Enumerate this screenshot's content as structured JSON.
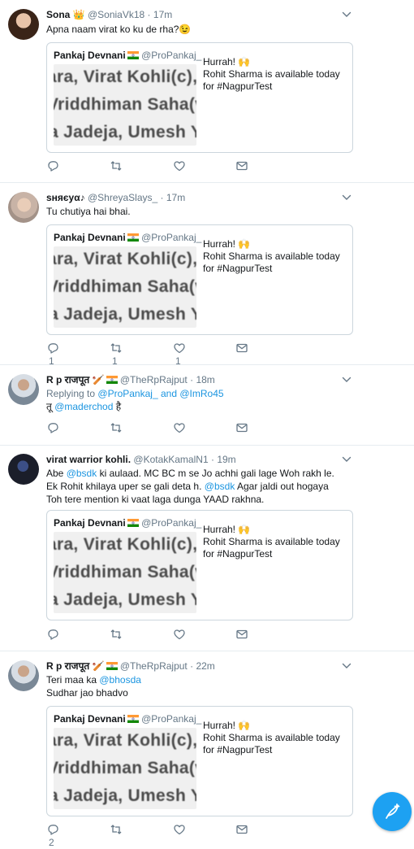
{
  "quote": {
    "author": "Pankaj Devnani",
    "handle": "@ProPankaj_",
    "line1": "Hurrah! 🙌",
    "line2": "Rohit Sharma is available today",
    "line3": "for #NagpurTest",
    "image_lines": [
      "ara, Virat Kohli(c),",
      "Vriddhiman Saha(v",
      "a Jadeja, Umesh Y"
    ]
  },
  "tweets": [
    {
      "name": "Sona 👑",
      "handle": "@SoniaVk18",
      "time": "17m",
      "text": "Apna naam virat ko ku de rha?😉",
      "actions": {
        "reply": "",
        "retweet": "",
        "like": ""
      }
    },
    {
      "name": "ѕняєуα♪",
      "handle": "@ShreyaSlays_",
      "time": "17m",
      "text": "Tu chutiya hai bhai.",
      "actions": {
        "reply": "1",
        "retweet": "1",
        "like": "1"
      }
    },
    {
      "name": "R p राजपूत 🏏",
      "handle": "@TheRpRajput",
      "time": "18m",
      "reply_prefix": "Replying to",
      "reply_to_1": "@ProPankaj_",
      "reply_and": "and",
      "reply_to_2": "@ImRo45",
      "text_pre": "तू",
      "text_link": "@maderchod",
      "text_post": "है",
      "actions": {
        "reply": "",
        "retweet": "",
        "like": ""
      }
    },
    {
      "name": "virat warrior kohli.",
      "handle": "@KotakKamalN1",
      "time": "19m",
      "text_a": "Abe",
      "link_a": "@bsdk",
      "text_b": "ki aulaad. MC BC m se Jo achhi gali lage Woh rakh le. Ek Rohit khilaya uper se gali deta h.",
      "link_b": "@bsdk",
      "text_c": "Agar jaldi out hogaya Toh tere mention ki vaat laga dunga YAAD rakhna.",
      "actions": {
        "reply": "",
        "retweet": "",
        "like": ""
      }
    },
    {
      "name": "R p राजपूत 🏏",
      "handle": "@TheRpRajput",
      "time": "22m",
      "text_pre": "Teri maa ka",
      "text_link": "@bhosda",
      "text_line2": "Sudhar jao bhadvo",
      "actions": {
        "reply": "2",
        "retweet": "",
        "like": ""
      }
    }
  ],
  "colors": {
    "accent": "#1da1f2",
    "link": "#1b95e0",
    "muted": "#657786",
    "border": "#e6ecf0"
  }
}
